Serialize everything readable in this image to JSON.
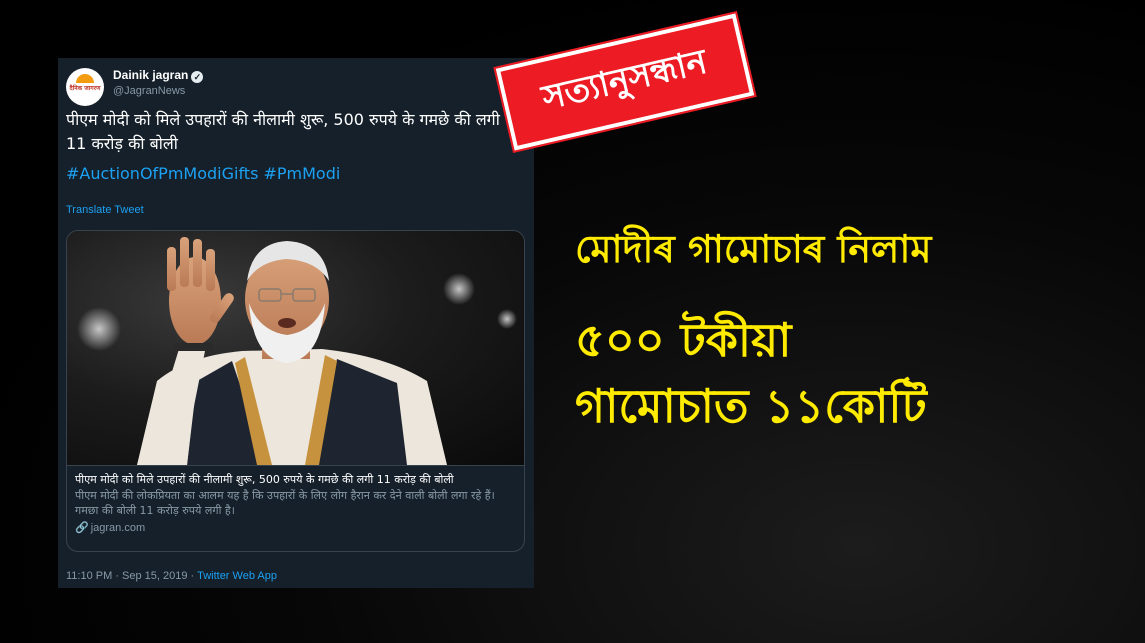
{
  "tweet": {
    "account_name": "Dainik jagran",
    "account_handle": "@JagranNews",
    "avatar_text": "दैनिक जागरण",
    "text": "पीएम मोदी को मिले उपहारों की नीलामी शुरू, 500 रुपये के गमछे की लगी 11 करोड़ की बोली",
    "hashtags": "#AuctionOfPmModiGifts #PmModi",
    "translate_label": "Translate Tweet",
    "card": {
      "title": "पीएम मोदी को मिले उपहारों की नीलामी शुरू, 500 रुपये के गमछे की लगी 11 करोड़ की बोली",
      "description": "पीएम मोदी की लोकप्रियता का आलम यह है कि उपहारों के लिए लोग हैरान कर देने वाली बोली लगा रहे हैं। गमछा की बोली 11 करोड़ रुपये लगी है।",
      "domain": "jagran.com"
    },
    "timestamp": "11:10 PM · Sep 15, 2019 · ",
    "source": "Twitter Web App"
  },
  "stamp": {
    "text": "সত্যানুসন্ধান",
    "color": "#ed1c24"
  },
  "headlines": {
    "line1": "মোদীৰ গামোচাৰ নিলাম",
    "line2": "৫০০ টকীয়া",
    "line3": "গামোচাত ১১কোটি",
    "color": "#ffeb00"
  },
  "icons": {
    "verified": "verified-badge-icon",
    "close": "close-icon",
    "link": "link-icon"
  }
}
